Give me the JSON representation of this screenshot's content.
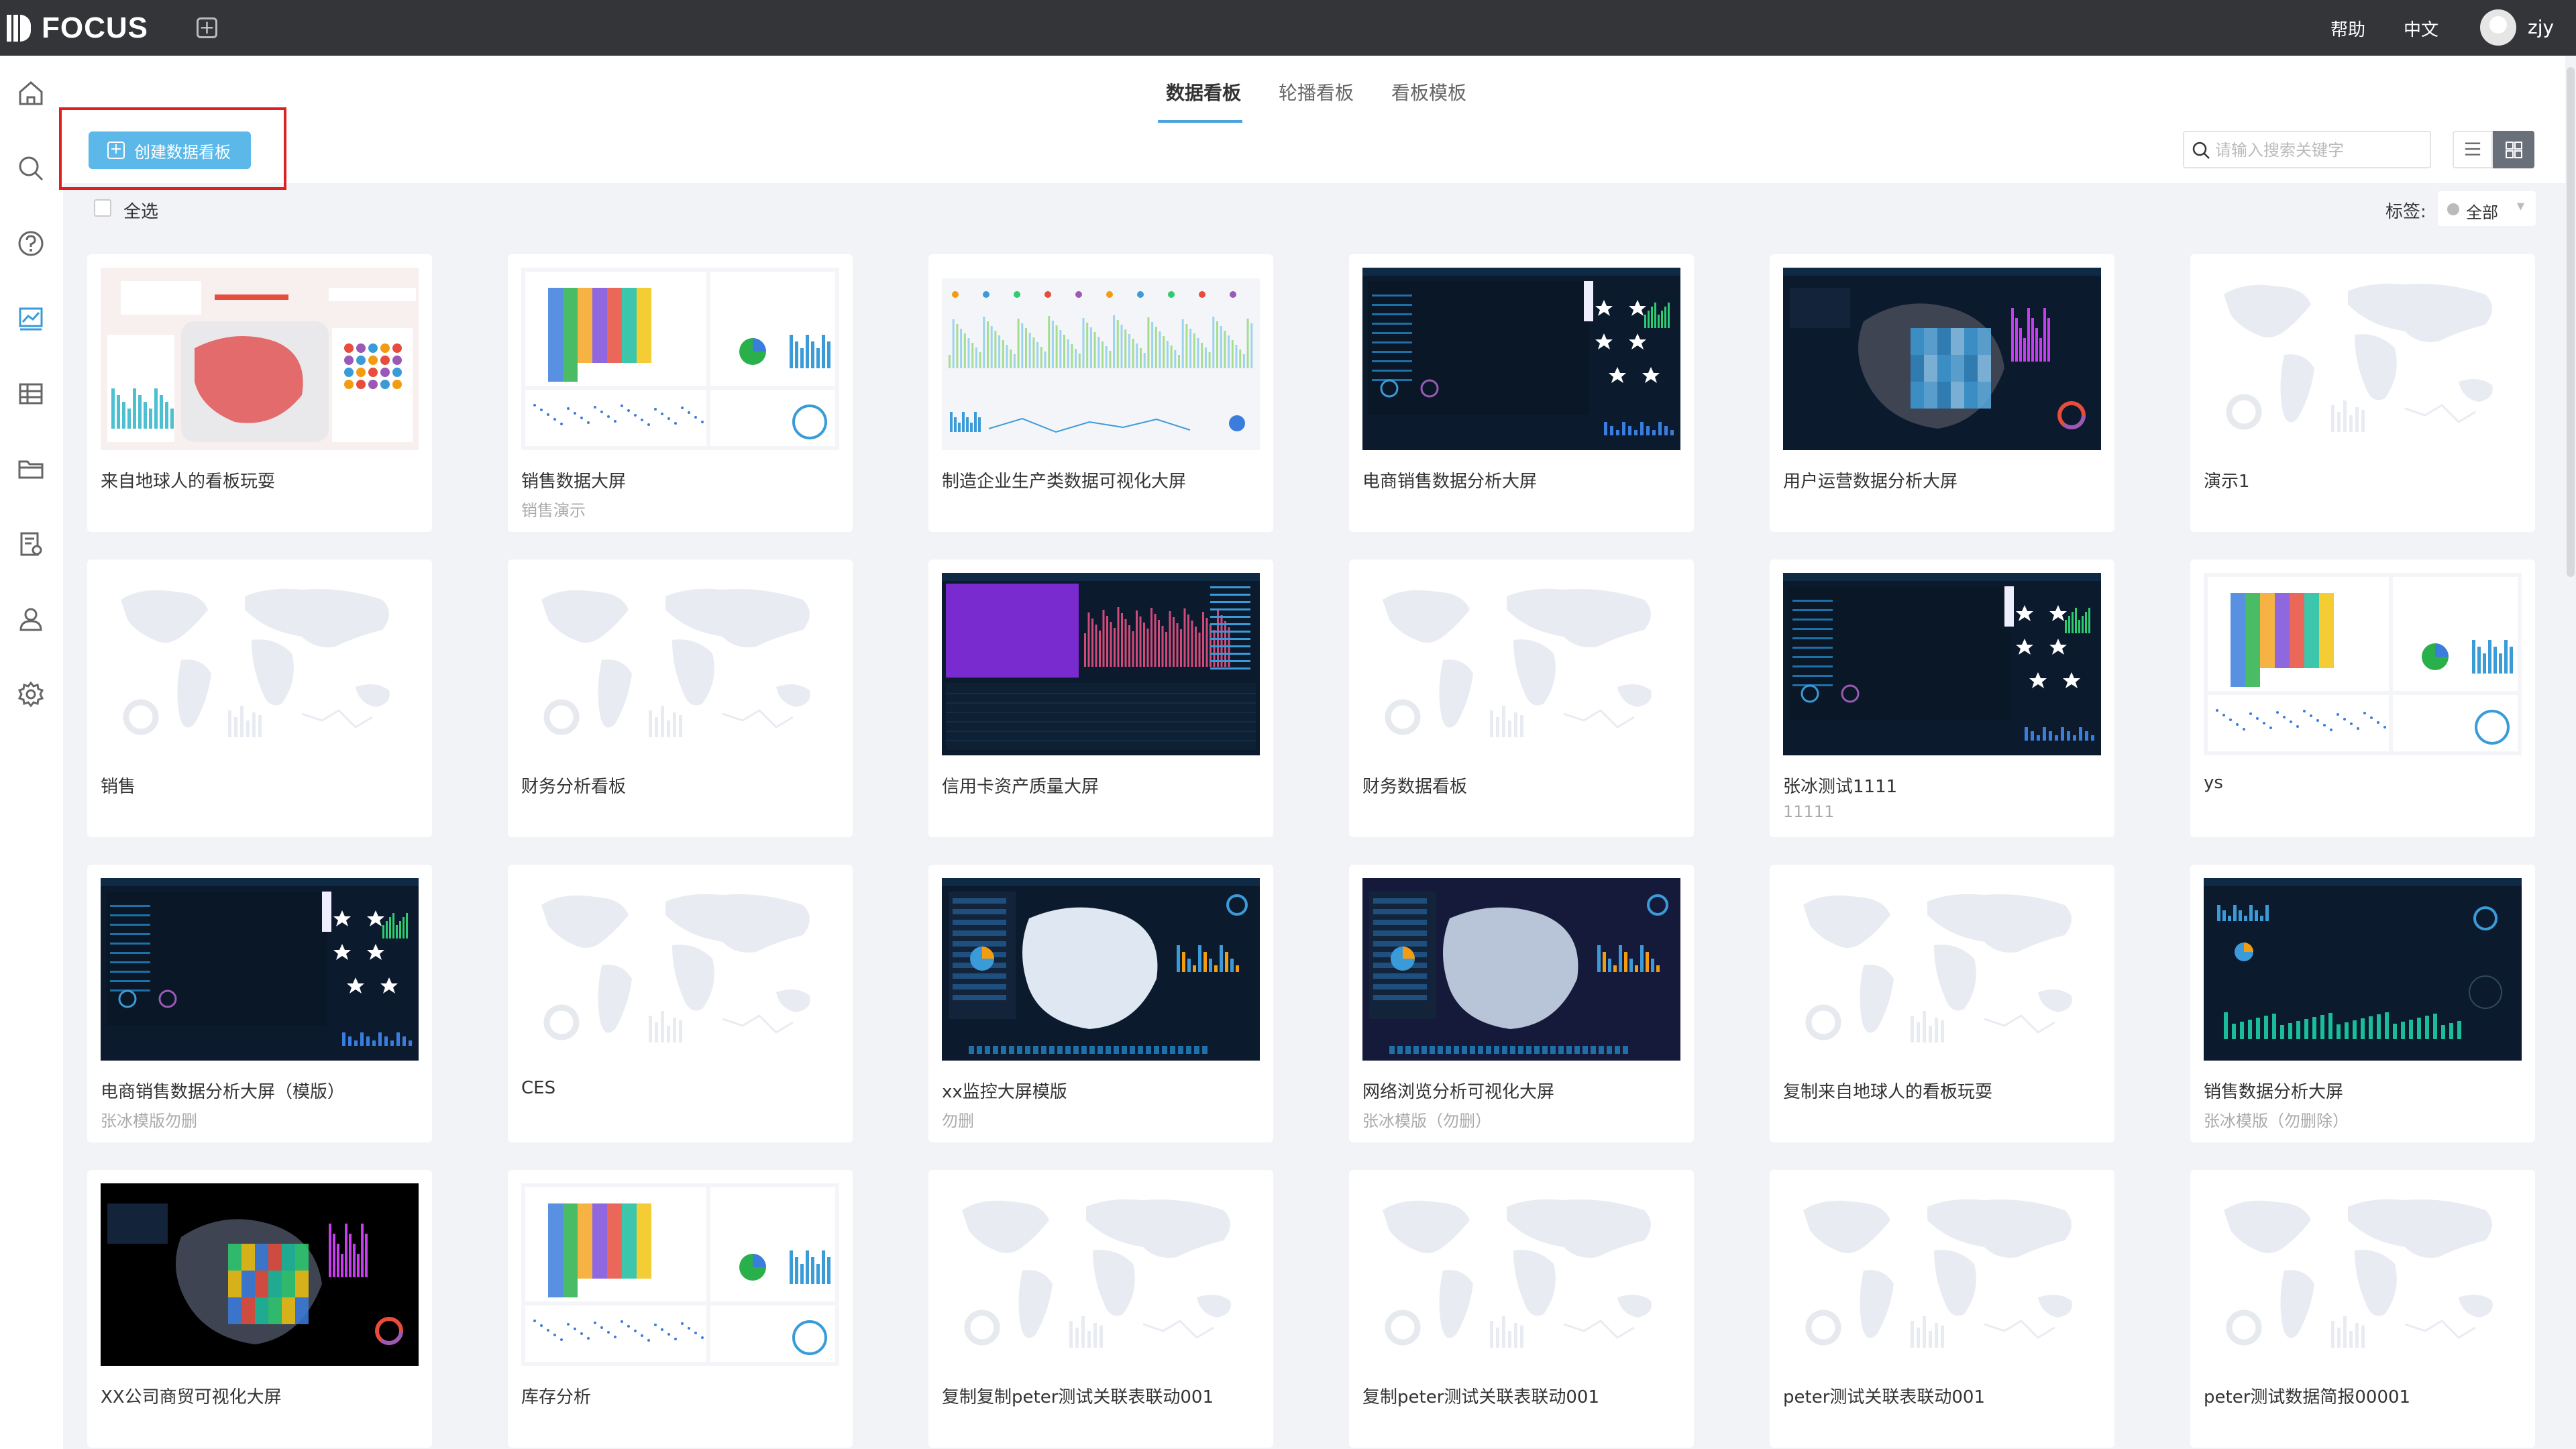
{
  "app": {
    "name": "FOCUS"
  },
  "topbar": {
    "help": "帮助",
    "language": "中文",
    "user": "zjy"
  },
  "sidebar": {
    "icons": [
      "home-icon",
      "search-icon",
      "help-icon",
      "dashboard-icon",
      "table-icon",
      "folder-icon",
      "settings-doc-icon",
      "user-icon",
      "gear-icon"
    ]
  },
  "tabs": [
    {
      "label": "数据看板",
      "active": true
    },
    {
      "label": "轮播看板",
      "active": false
    },
    {
      "label": "看板模板",
      "active": false
    }
  ],
  "toolbar": {
    "create_label": "创建数据看板",
    "search_placeholder": "请输入搜索关键字",
    "select_all": "全选",
    "tag_label": "标签:",
    "tag_value": "全部"
  },
  "colors": {
    "accent": "#5bb8e8",
    "highlight": "#e02020",
    "topbar": "#343538"
  },
  "cards": [
    {
      "title": "来自地球人的看板玩耍",
      "subtitle": "",
      "thumb": "light-map"
    },
    {
      "title": "销售数据大屏",
      "subtitle": "销售演示",
      "thumb": "light-colormap"
    },
    {
      "title": "制造企业生产类数据可视化大屏",
      "subtitle": "",
      "thumb": "light-bars"
    },
    {
      "title": "电商销售数据分析大屏",
      "subtitle": "",
      "thumb": "dark-stars"
    },
    {
      "title": "用户运营数据分析大屏",
      "subtitle": "",
      "thumb": "dark-map"
    },
    {
      "title": "演示1",
      "subtitle": "",
      "thumb": "placeholder"
    },
    {
      "title": "销售",
      "subtitle": "",
      "thumb": "placeholder"
    },
    {
      "title": "财务分析看板",
      "subtitle": "",
      "thumb": "placeholder"
    },
    {
      "title": "信用卡资产质量大屏",
      "subtitle": "",
      "thumb": "dark-purple"
    },
    {
      "title": "财务数据看板",
      "subtitle": "",
      "thumb": "placeholder"
    },
    {
      "title": "张冰测试1111",
      "subtitle": "11111",
      "thumb": "dark-stars"
    },
    {
      "title": "ys",
      "subtitle": "",
      "thumb": "light-colormap"
    },
    {
      "title": "电商销售数据分析大屏（模版）",
      "subtitle": "张冰模版勿删",
      "thumb": "dark-stars"
    },
    {
      "title": "CES",
      "subtitle": "",
      "thumb": "placeholder"
    },
    {
      "title": "xx监控大屏模版",
      "subtitle": "勿删",
      "thumb": "dark-map-white"
    },
    {
      "title": "网络浏览分析可视化大屏",
      "subtitle": "张冰模版（勿删）",
      "thumb": "dark-map-purple"
    },
    {
      "title": "复制来自地球人的看板玩耍",
      "subtitle": "",
      "thumb": "placeholder"
    },
    {
      "title": "销售数据分析大屏",
      "subtitle": "张冰模版（勿删除）",
      "thumb": "dark-bars"
    },
    {
      "title": "XX公司商贸可视化大屏",
      "subtitle": "",
      "thumb": "dark-colormap"
    },
    {
      "title": "库存分析",
      "subtitle": "",
      "thumb": "light-colormap"
    },
    {
      "title": "复制复制peter测试关联表联动001",
      "subtitle": "",
      "thumb": "placeholder"
    },
    {
      "title": "复制peter测试关联表联动001",
      "subtitle": "",
      "thumb": "placeholder"
    },
    {
      "title": "peter测试关联表联动001",
      "subtitle": "",
      "thumb": "placeholder"
    },
    {
      "title": "peter测试数据简报00001",
      "subtitle": "",
      "thumb": "placeholder"
    }
  ]
}
